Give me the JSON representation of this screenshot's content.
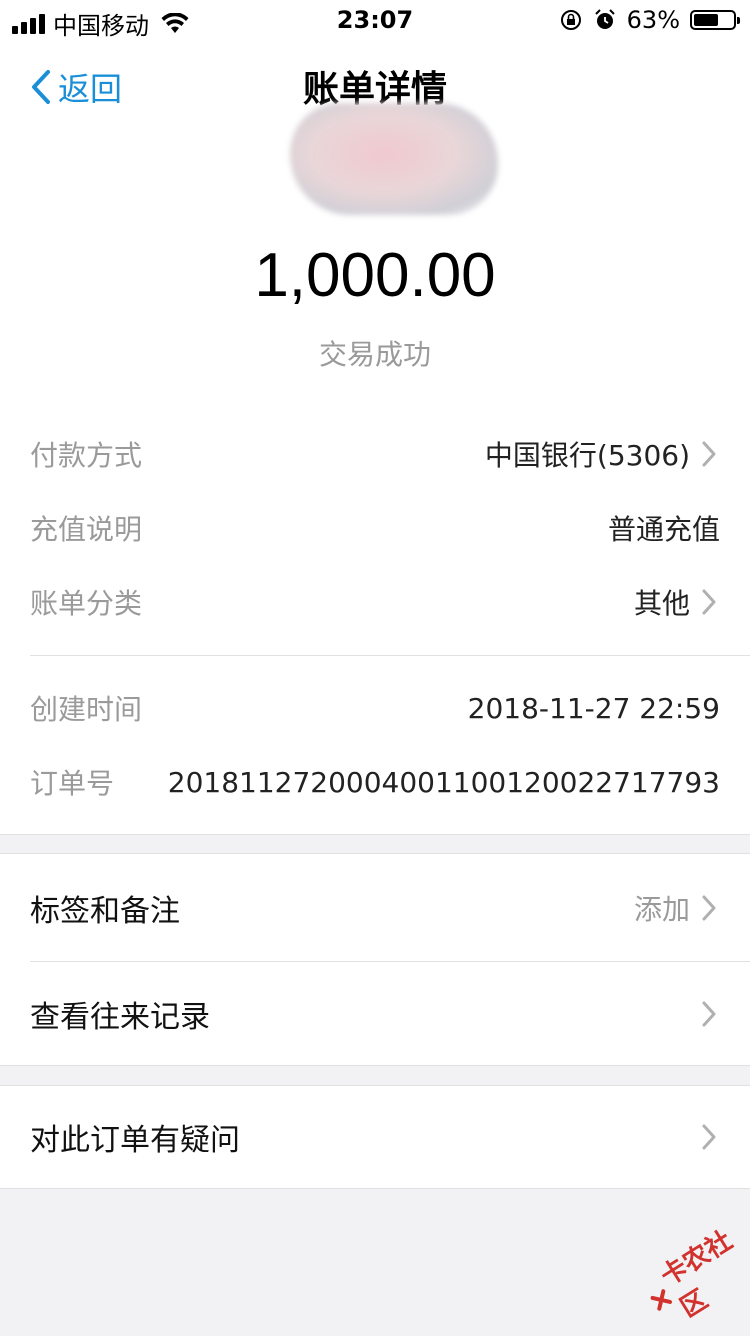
{
  "status_bar": {
    "carrier": "中国移动",
    "time": "23:07",
    "battery": "63%",
    "battery_level": 0.63
  },
  "nav": {
    "back": "返回",
    "title": "账单详情"
  },
  "summary": {
    "amount": "1,000.00",
    "status": "交易成功"
  },
  "details": [
    {
      "key": "付款方式",
      "value": "中国银行(5306)"
    },
    {
      "key": "充值说明",
      "value": "普通充值"
    },
    {
      "key": "账单分类",
      "value": "其他"
    },
    {
      "key": "创建时间",
      "value": "2018-11-27 22:59"
    },
    {
      "key": "订单号",
      "value": "2018112720004001100120022717793"
    }
  ],
  "actions": {
    "tags": {
      "label": "标签和备注",
      "value": "添加"
    },
    "history": {
      "label": "查看往来记录"
    },
    "question": {
      "label": "对此订单有疑问"
    }
  },
  "watermark": "卡农社区",
  "colors": {
    "accent": "#1a8fd8",
    "muted": "#9a9a9a",
    "background": "#f2f2f5"
  }
}
